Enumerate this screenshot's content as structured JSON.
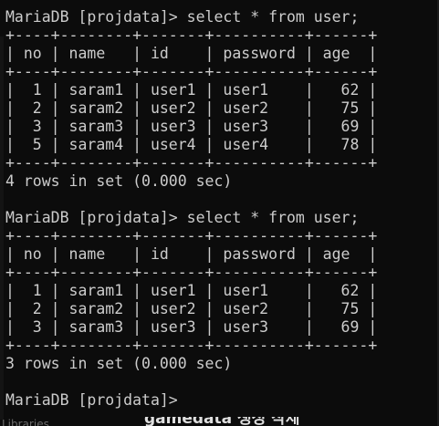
{
  "terminal": {
    "lines": [
      "MariaDB [projdata]> select * from user;",
      "+----+--------+-------+----------+------+",
      "| no | name   | id    | password | age  |",
      "+----+--------+-------+----------+------+",
      "|  1 | saram1 | user1 | user1    |   62 |",
      "|  2 | saram2 | user2 | user2    |   75 |",
      "|  3 | saram3 | user3 | user3    |   69 |",
      "|  5 | saram4 | user4 | user4    |   78 |",
      "+----+--------+-------+----------+------+",
      "4 rows in set (0.000 sec)",
      "",
      "MariaDB [projdata]> select * from user;",
      "+----+--------+-------+----------+------+",
      "| no | name   | id    | password | age  |",
      "+----+--------+-------+----------+------+",
      "|  1 | saram1 | user1 | user1    |   62 |",
      "|  2 | saram2 | user2 | user2    |   75 |",
      "|  3 | saram3 | user3 | user3    |   69 |",
      "+----+--------+-------+----------+------+",
      "3 rows in set (0.000 sec)",
      "",
      "MariaDB [projdata]>"
    ]
  },
  "background_window": {
    "left_text": "Libraries",
    "mid_text": "gamedata 생성 삭제"
  }
}
